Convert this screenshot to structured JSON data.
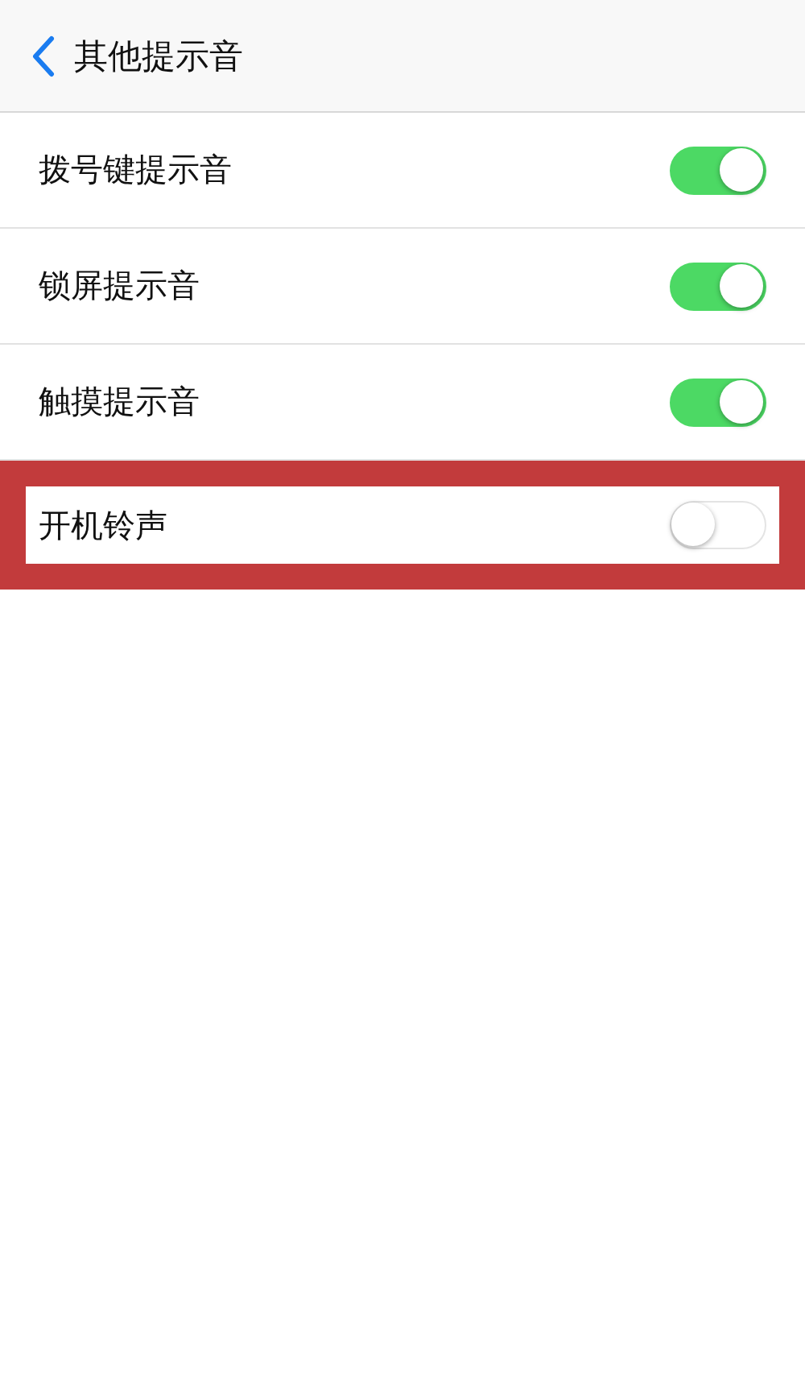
{
  "nav": {
    "title": "其他提示音"
  },
  "settings": [
    {
      "label": "拨号键提示音",
      "on": true,
      "highlighted": false
    },
    {
      "label": "锁屏提示音",
      "on": true,
      "highlighted": false
    },
    {
      "label": "触摸提示音",
      "on": true,
      "highlighted": false
    },
    {
      "label": "开机铃声",
      "on": false,
      "highlighted": true
    }
  ]
}
